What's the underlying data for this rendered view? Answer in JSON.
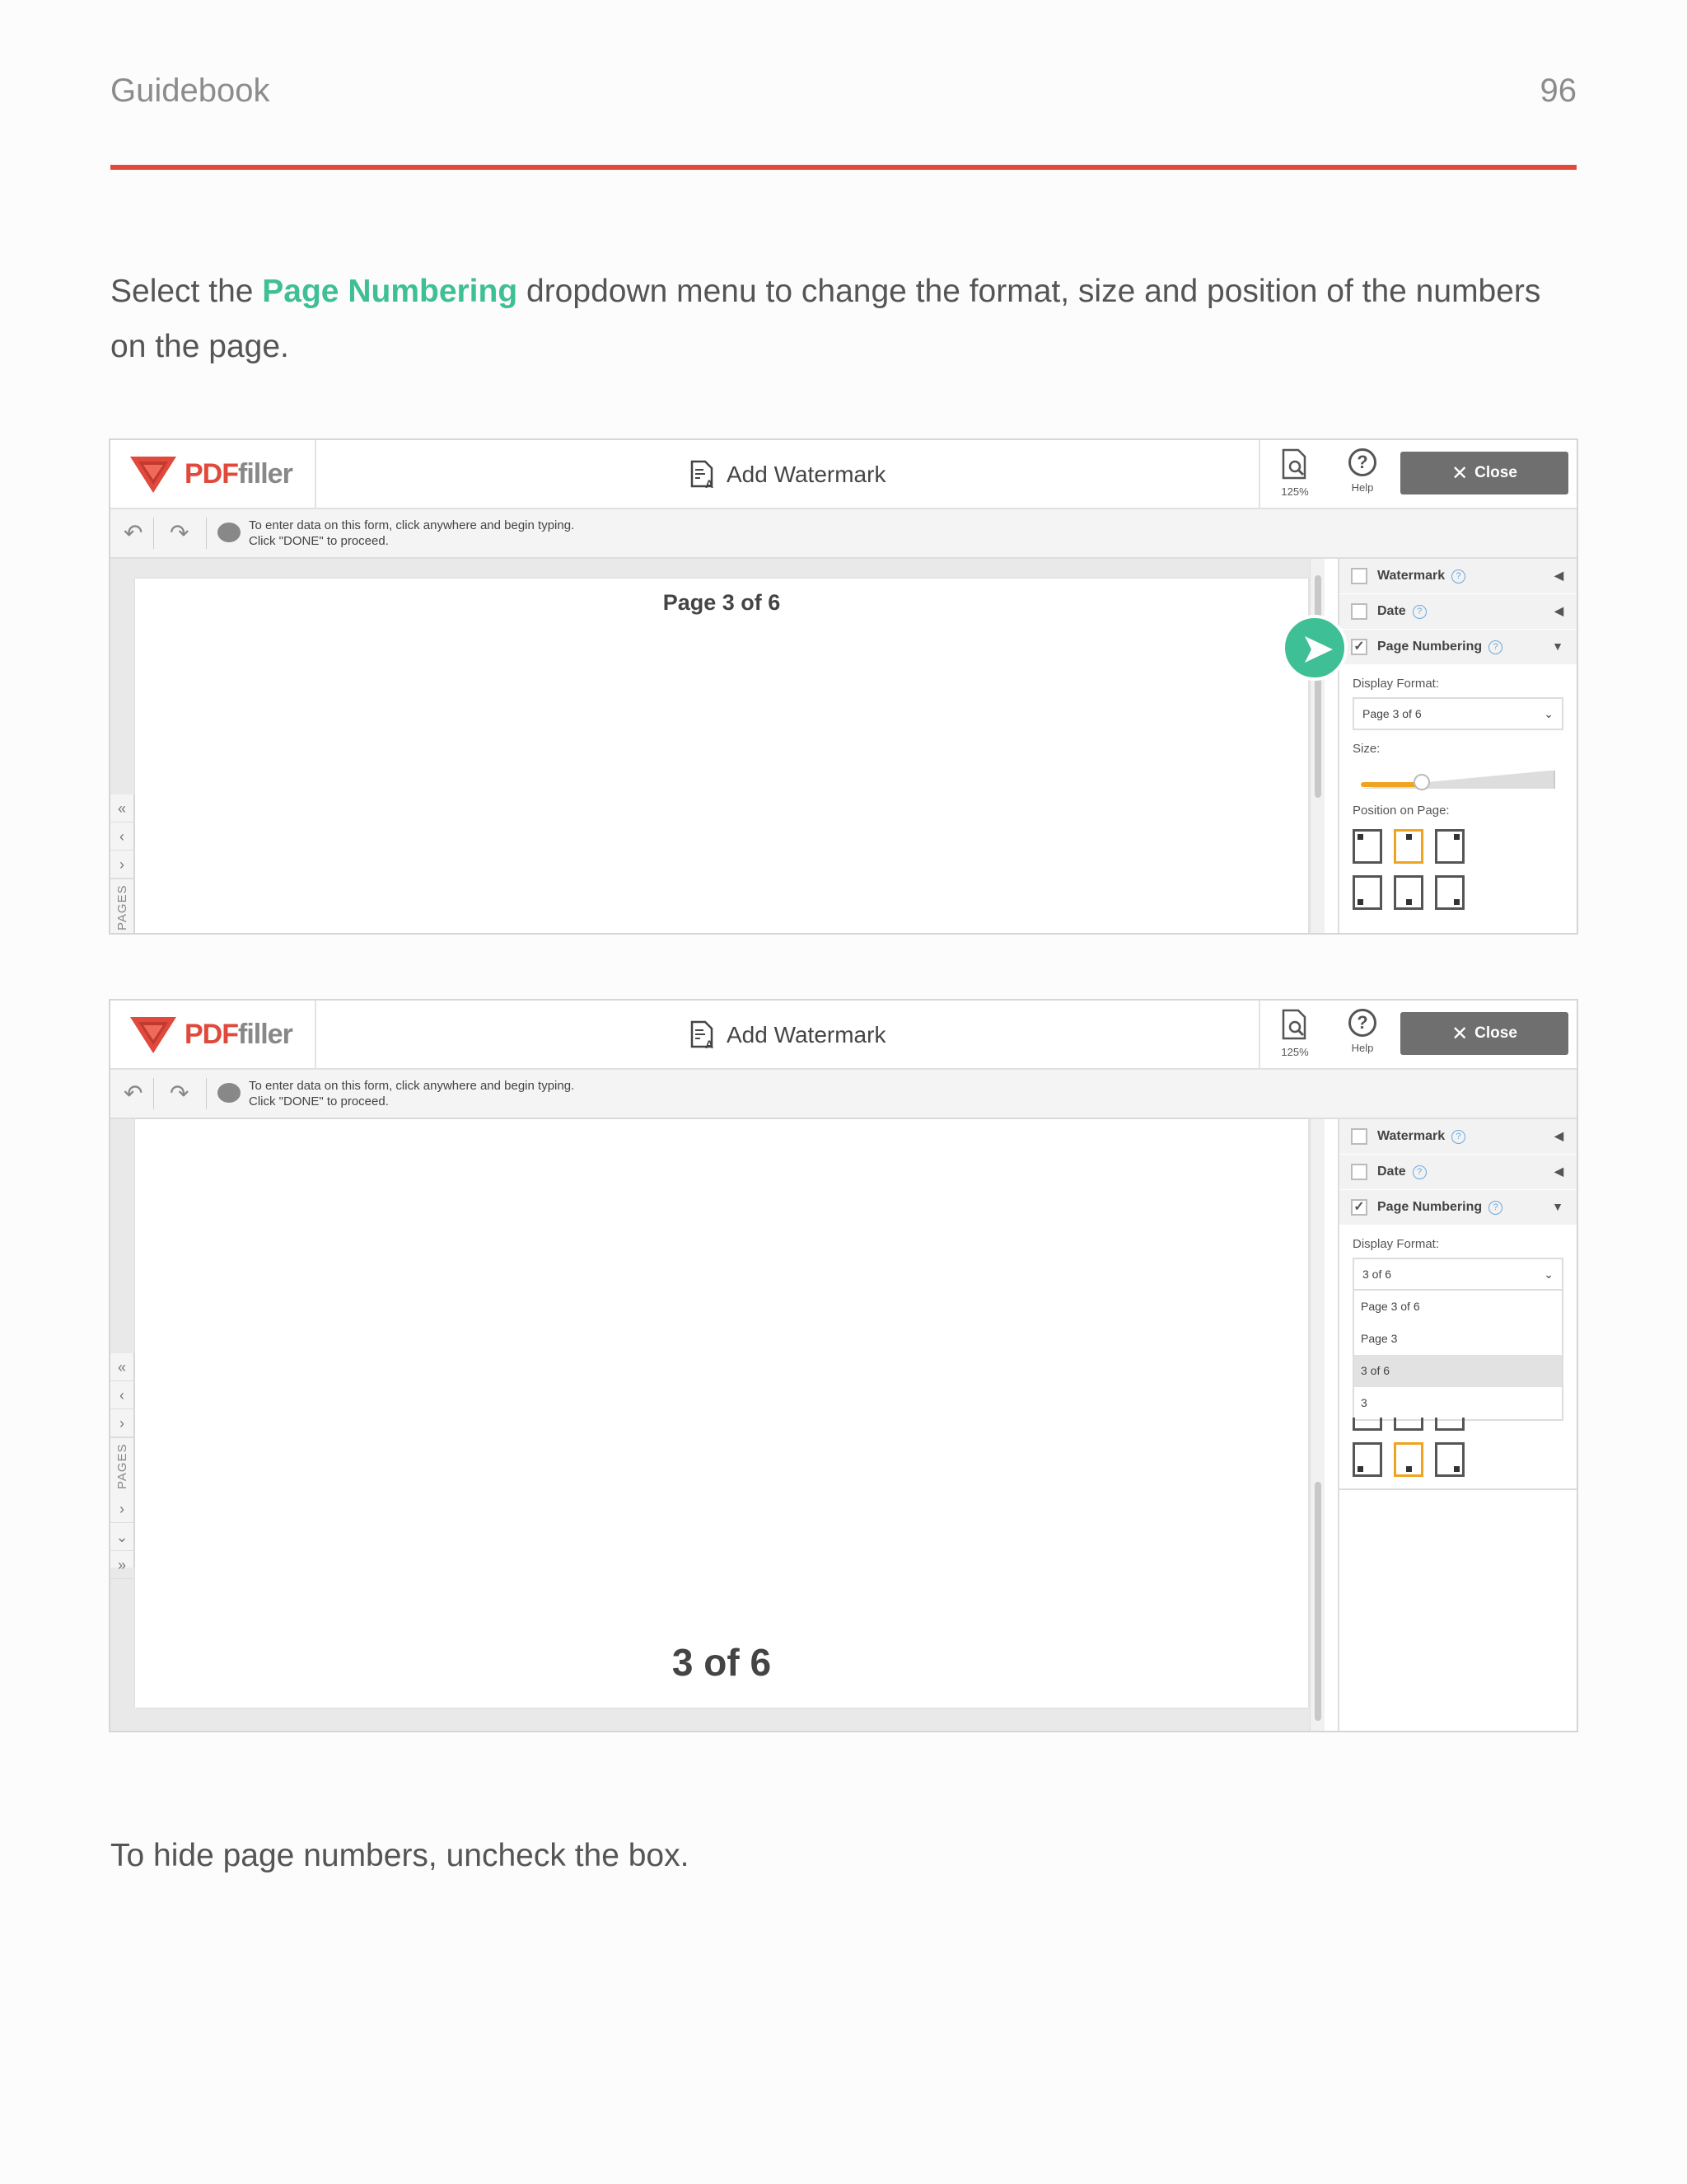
{
  "header": {
    "title": "Guidebook",
    "page_number": "96"
  },
  "intro": {
    "prefix": "Select the ",
    "highlight": "Page Numbering",
    "suffix": " dropdown menu to change the format, size and position of the numbers on the page."
  },
  "footer_text": "To hide page numbers, uncheck the box.",
  "colors": {
    "accent_red": "#e0493b",
    "highlight_green": "#3fbf95",
    "selected_orange": "#f0a31e"
  },
  "editor": {
    "logo_pdf": "PDF",
    "logo_filler": "filler",
    "tool_title": "Add Watermark",
    "zoom_label": "125%",
    "help_label": "Help",
    "close_label": "Close",
    "hint_line1": "To enter data on this form, click anywhere and begin typing.",
    "hint_line2": "Click \"DONE\" to proceed.",
    "pages_label": "PAGES"
  },
  "panel": {
    "watermark_label": "Watermark",
    "date_label": "Date",
    "page_numbering_label": "Page Numbering",
    "display_format_label": "Display Format:",
    "size_label": "Size:",
    "position_label": "Position on Page:"
  },
  "screenshot1": {
    "page_label": "Page 3 of 6",
    "display_format_value": "Page 3 of 6"
  },
  "screenshot2": {
    "page_label": "3 of 6",
    "display_format_value": "3 of 6",
    "dropdown_options": [
      "Page 3 of 6",
      "Page 3",
      "3 of 6",
      "3"
    ],
    "dropdown_selected": "3 of 6"
  }
}
